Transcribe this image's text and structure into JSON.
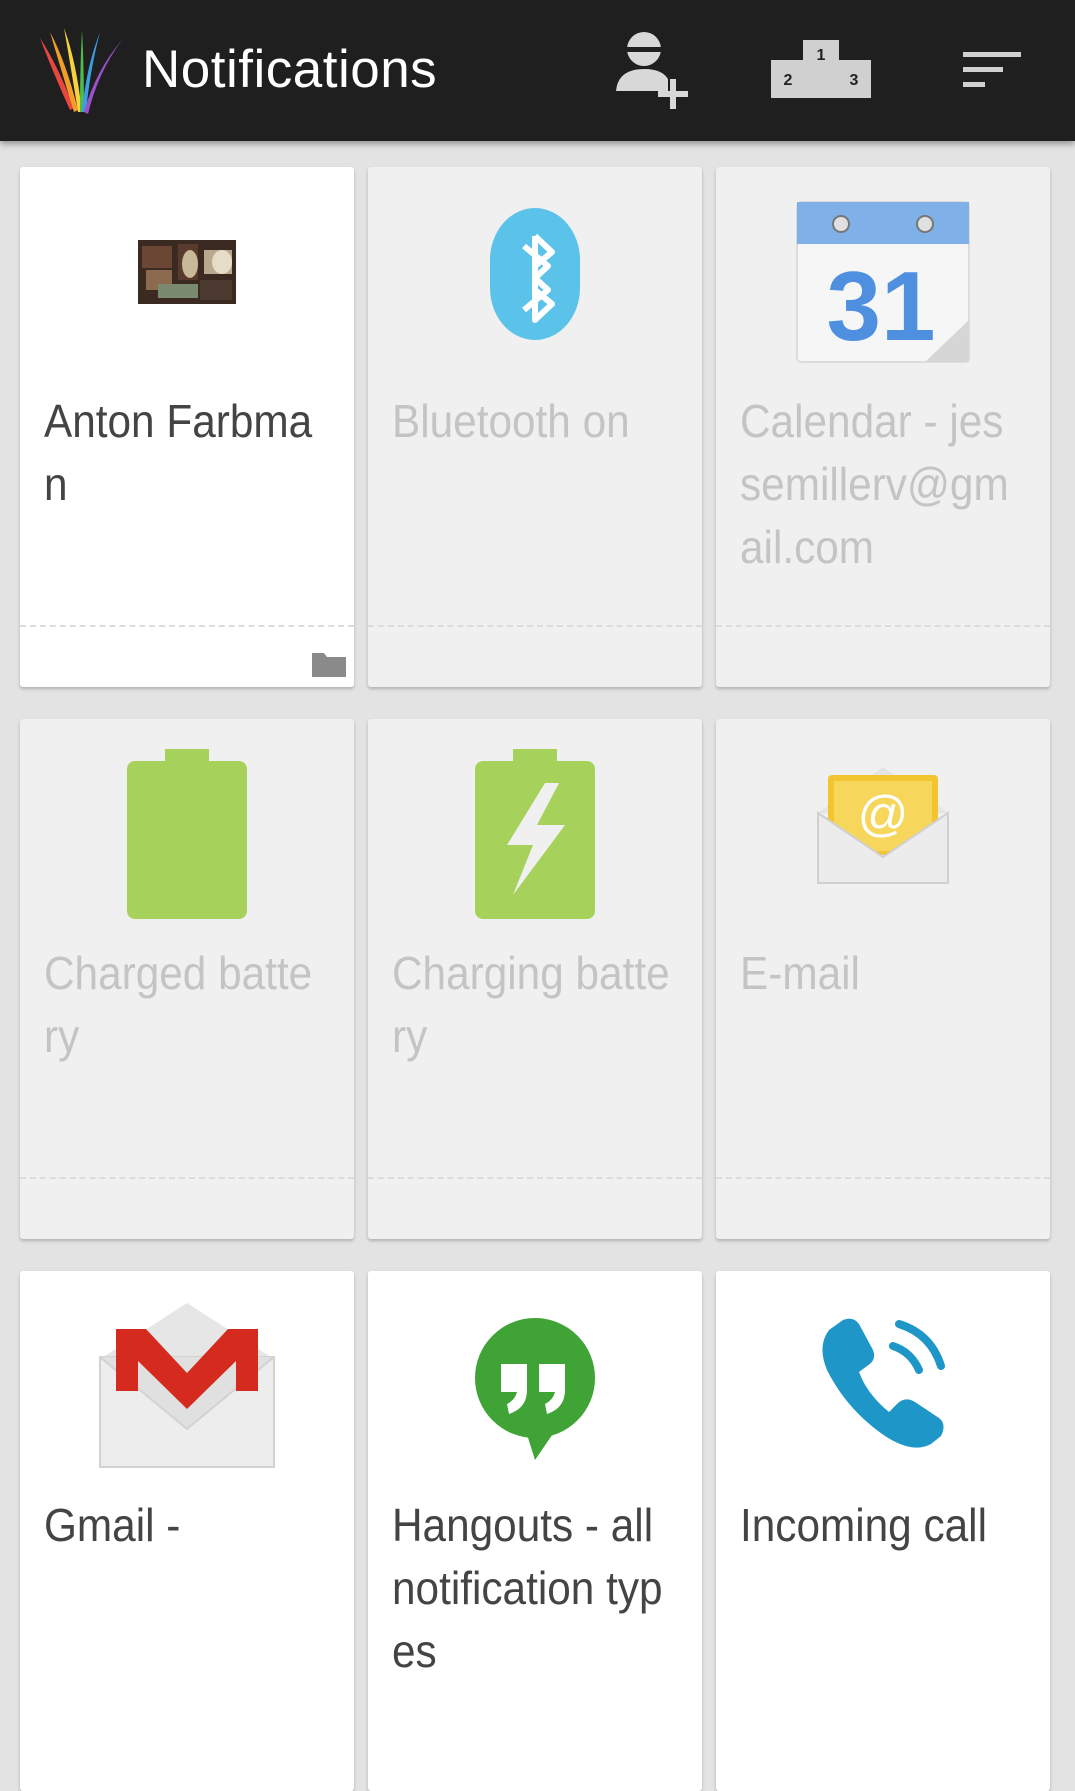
{
  "appbar": {
    "title": "Notifications",
    "actions": [
      "add-contact",
      "leaderboard",
      "sort"
    ],
    "podium_ranks": [
      "1",
      "2",
      "3"
    ]
  },
  "colors": {
    "appbar_bg": "#1f1f1f",
    "card_inactive": "#f0f0f0",
    "card_active": "#ffffff",
    "battery_green": "#a6d15b",
    "bluetooth_blue": "#5bc3ea",
    "calendar_blue": "#4e8fe0",
    "hangouts_green": "#3fa336",
    "call_teal": "#1e97c8",
    "gmail_red": "#d52b1e"
  },
  "cards": [
    {
      "label": "Anton Farbman",
      "icon": "contact-photo",
      "active": true
    },
    {
      "label": "Bluetooth on",
      "icon": "bluetooth-icon",
      "active": false
    },
    {
      "label": "Calendar - jessemillerv@gmail.com",
      "icon": "calendar-icon",
      "active": false,
      "calendar_day": "31"
    },
    {
      "label": "Charged battery",
      "icon": "battery-icon",
      "active": false
    },
    {
      "label": "Charging battery",
      "icon": "charging-battery-icon",
      "active": false
    },
    {
      "label": "E-mail",
      "icon": "email-icon",
      "active": false,
      "email_symbol": "@"
    },
    {
      "label": "Gmail -",
      "icon": "gmail-icon",
      "active": true
    },
    {
      "label": "Hangouts - all notification types",
      "icon": "hangouts-icon",
      "active": true
    },
    {
      "label": "Incoming call",
      "icon": "phone-icon",
      "active": true
    }
  ]
}
